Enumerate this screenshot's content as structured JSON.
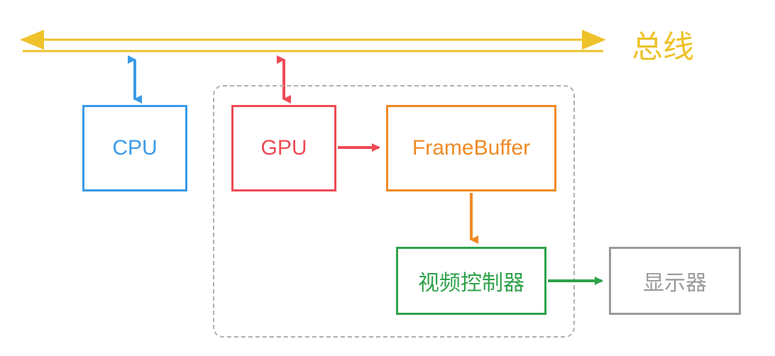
{
  "colors": {
    "bus": "#eec22a",
    "cpu": "#3a9ae8",
    "gpu": "#ee4a55",
    "framebuffer": "#f08a24",
    "video": "#2fa24a",
    "display": "#9a9a9a",
    "group": "#b0b0b0"
  },
  "labels": {
    "bus": "总线",
    "cpu": "CPU",
    "gpu": "GPU",
    "framebuffer": "FrameBuffer",
    "video_controller": "视频控制器",
    "display": "显示器"
  },
  "diagram": {
    "description": "CPU 与 GPU 通过总线通信；GPU 内含 FrameBuffer，视频控制器读取后输出到显示器。",
    "nodes": [
      {
        "id": "bus",
        "type": "bus"
      },
      {
        "id": "cpu",
        "type": "block"
      },
      {
        "id": "gpu",
        "type": "block"
      },
      {
        "id": "framebuffer",
        "type": "block"
      },
      {
        "id": "video_controller",
        "type": "block"
      },
      {
        "id": "display",
        "type": "block"
      }
    ],
    "edges": [
      {
        "from": "cpu",
        "to": "bus",
        "dir": "bidirectional"
      },
      {
        "from": "gpu",
        "to": "bus",
        "dir": "bidirectional"
      },
      {
        "from": "gpu",
        "to": "framebuffer",
        "dir": "forward"
      },
      {
        "from": "framebuffer",
        "to": "video_controller",
        "dir": "forward"
      },
      {
        "from": "video_controller",
        "to": "display",
        "dir": "forward"
      }
    ],
    "group": [
      "gpu",
      "framebuffer",
      "video_controller"
    ]
  }
}
